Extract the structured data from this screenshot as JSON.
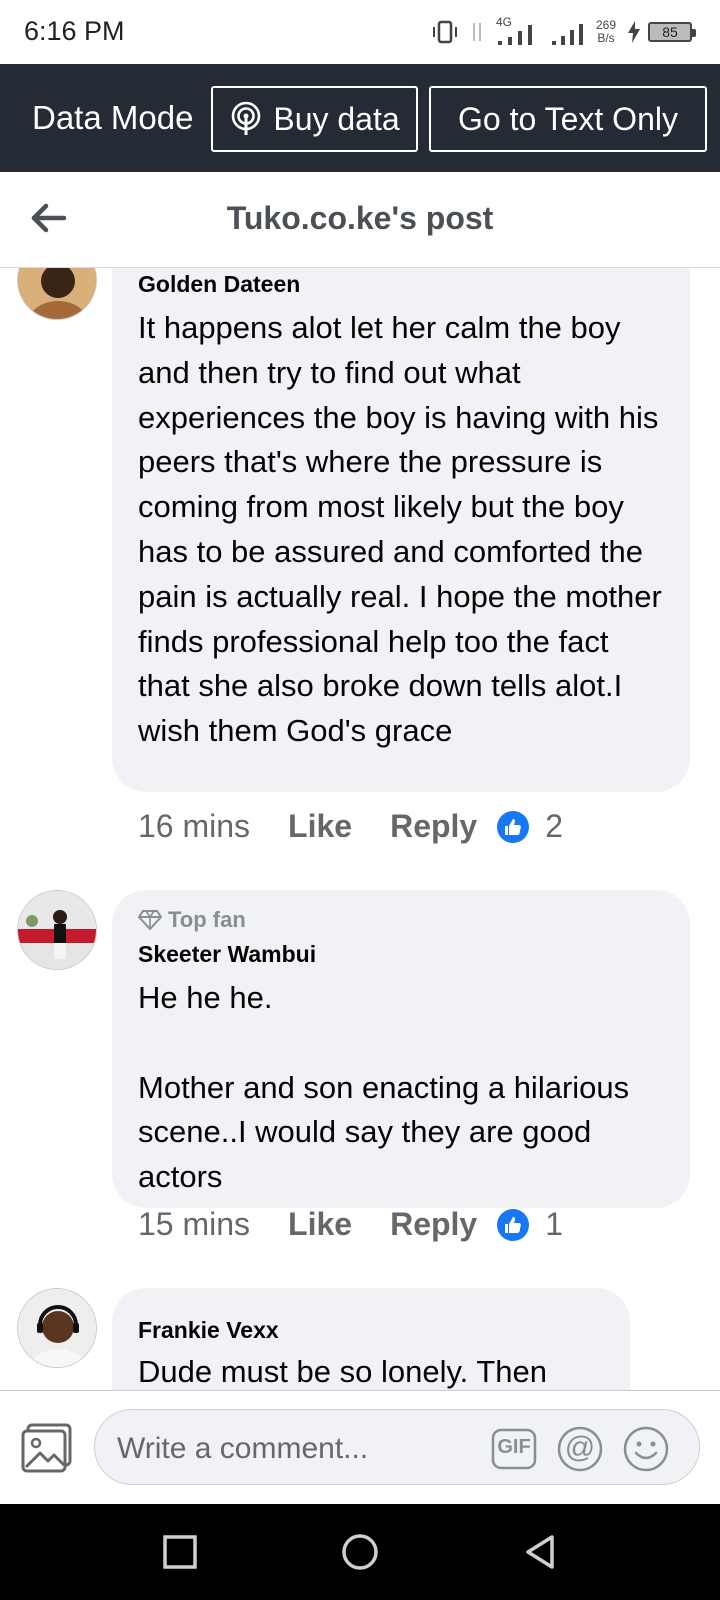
{
  "status": {
    "time": "6:16 PM",
    "net_speed_value": "269",
    "net_speed_unit": "B/s",
    "network": "4G",
    "battery": "85"
  },
  "data_bar": {
    "mode_label": "Data Mode",
    "buy_data": "Buy data",
    "text_only": "Go to Text Only",
    "background": "#252b35"
  },
  "header": {
    "title": "Tuko.co.ke's post"
  },
  "comments": [
    {
      "author": "Golden Dateen",
      "text": "It happens alot let her calm the boy and then try to find out what experiences the boy is having with his peers that's where the pressure is coming from most likely but the boy has to be assured and comforted the pain is actually real. I hope the mother finds professional help too the fact that she also broke down tells alot.I wish them God's grace",
      "time": "16 mins",
      "like": "Like",
      "reply": "Reply",
      "likes": "2"
    },
    {
      "badge": "Top fan",
      "author": "Skeeter Wambui",
      "text": "He he he.\n\nMother and son enacting a hilarious scene..I would say they are good actors",
      "time": "15 mins",
      "like": "Like",
      "reply": "Reply",
      "likes": "1"
    },
    {
      "author": "Frankie Vexx",
      "text": "Dude must be so lonely. Then"
    }
  ],
  "composer": {
    "placeholder": "Write a comment...",
    "gif": "GIF",
    "at": "@"
  },
  "colors": {
    "accent": "#1877f2",
    "bubble": "#f0f2f5",
    "secondary_text": "#65676b"
  },
  "icons": [
    "back-arrow-icon",
    "hotspot-icon",
    "photo-icon",
    "gif-icon",
    "mention-icon",
    "emoji-icon",
    "thumbs-up-icon",
    "diamond-icon",
    "square-nav-icon",
    "circle-nav-icon",
    "triangle-nav-icon"
  ]
}
